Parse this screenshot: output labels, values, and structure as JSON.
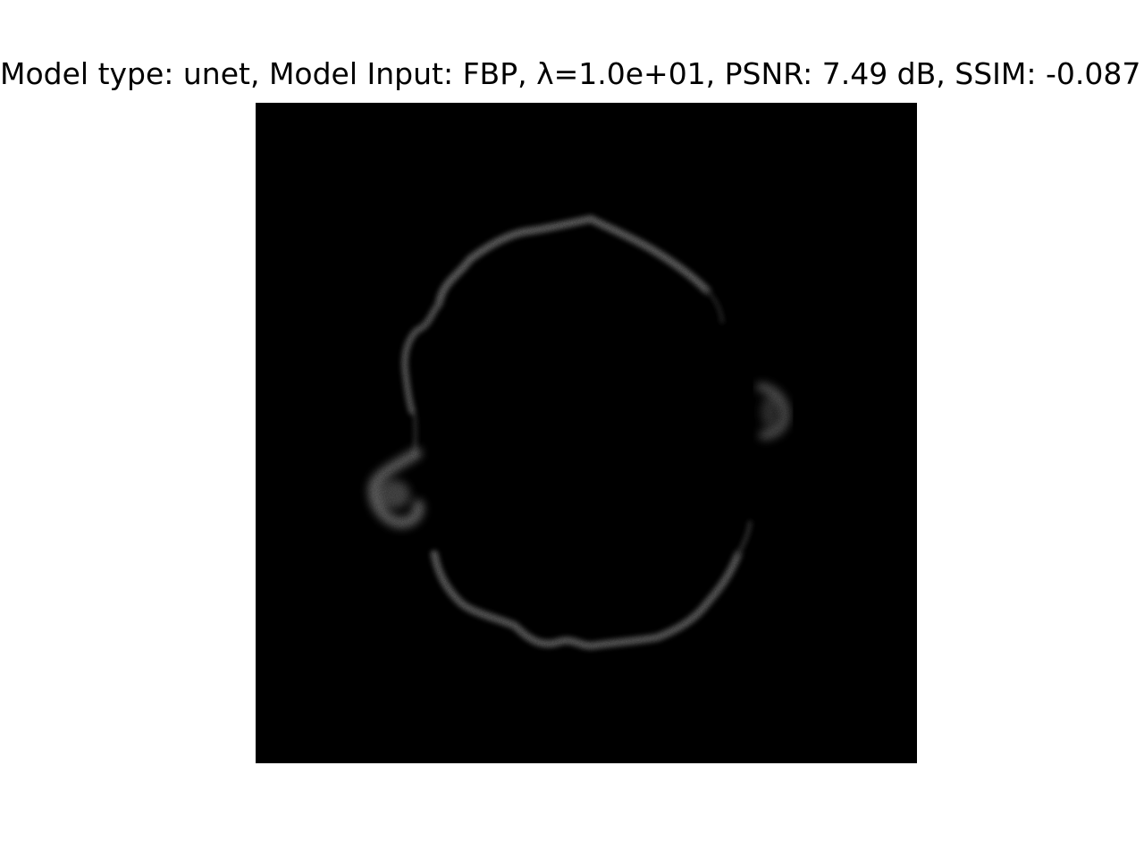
{
  "figure": {
    "title": "Model type: unet, Model Input: FBP, λ=1.0e+01, PSNR: 7.49 dB, SSIM: -0.087",
    "image": {
      "description_icon": "ct-reconstruction-image",
      "background_color": "#000000",
      "structure_color": "#5a5a5a"
    }
  }
}
